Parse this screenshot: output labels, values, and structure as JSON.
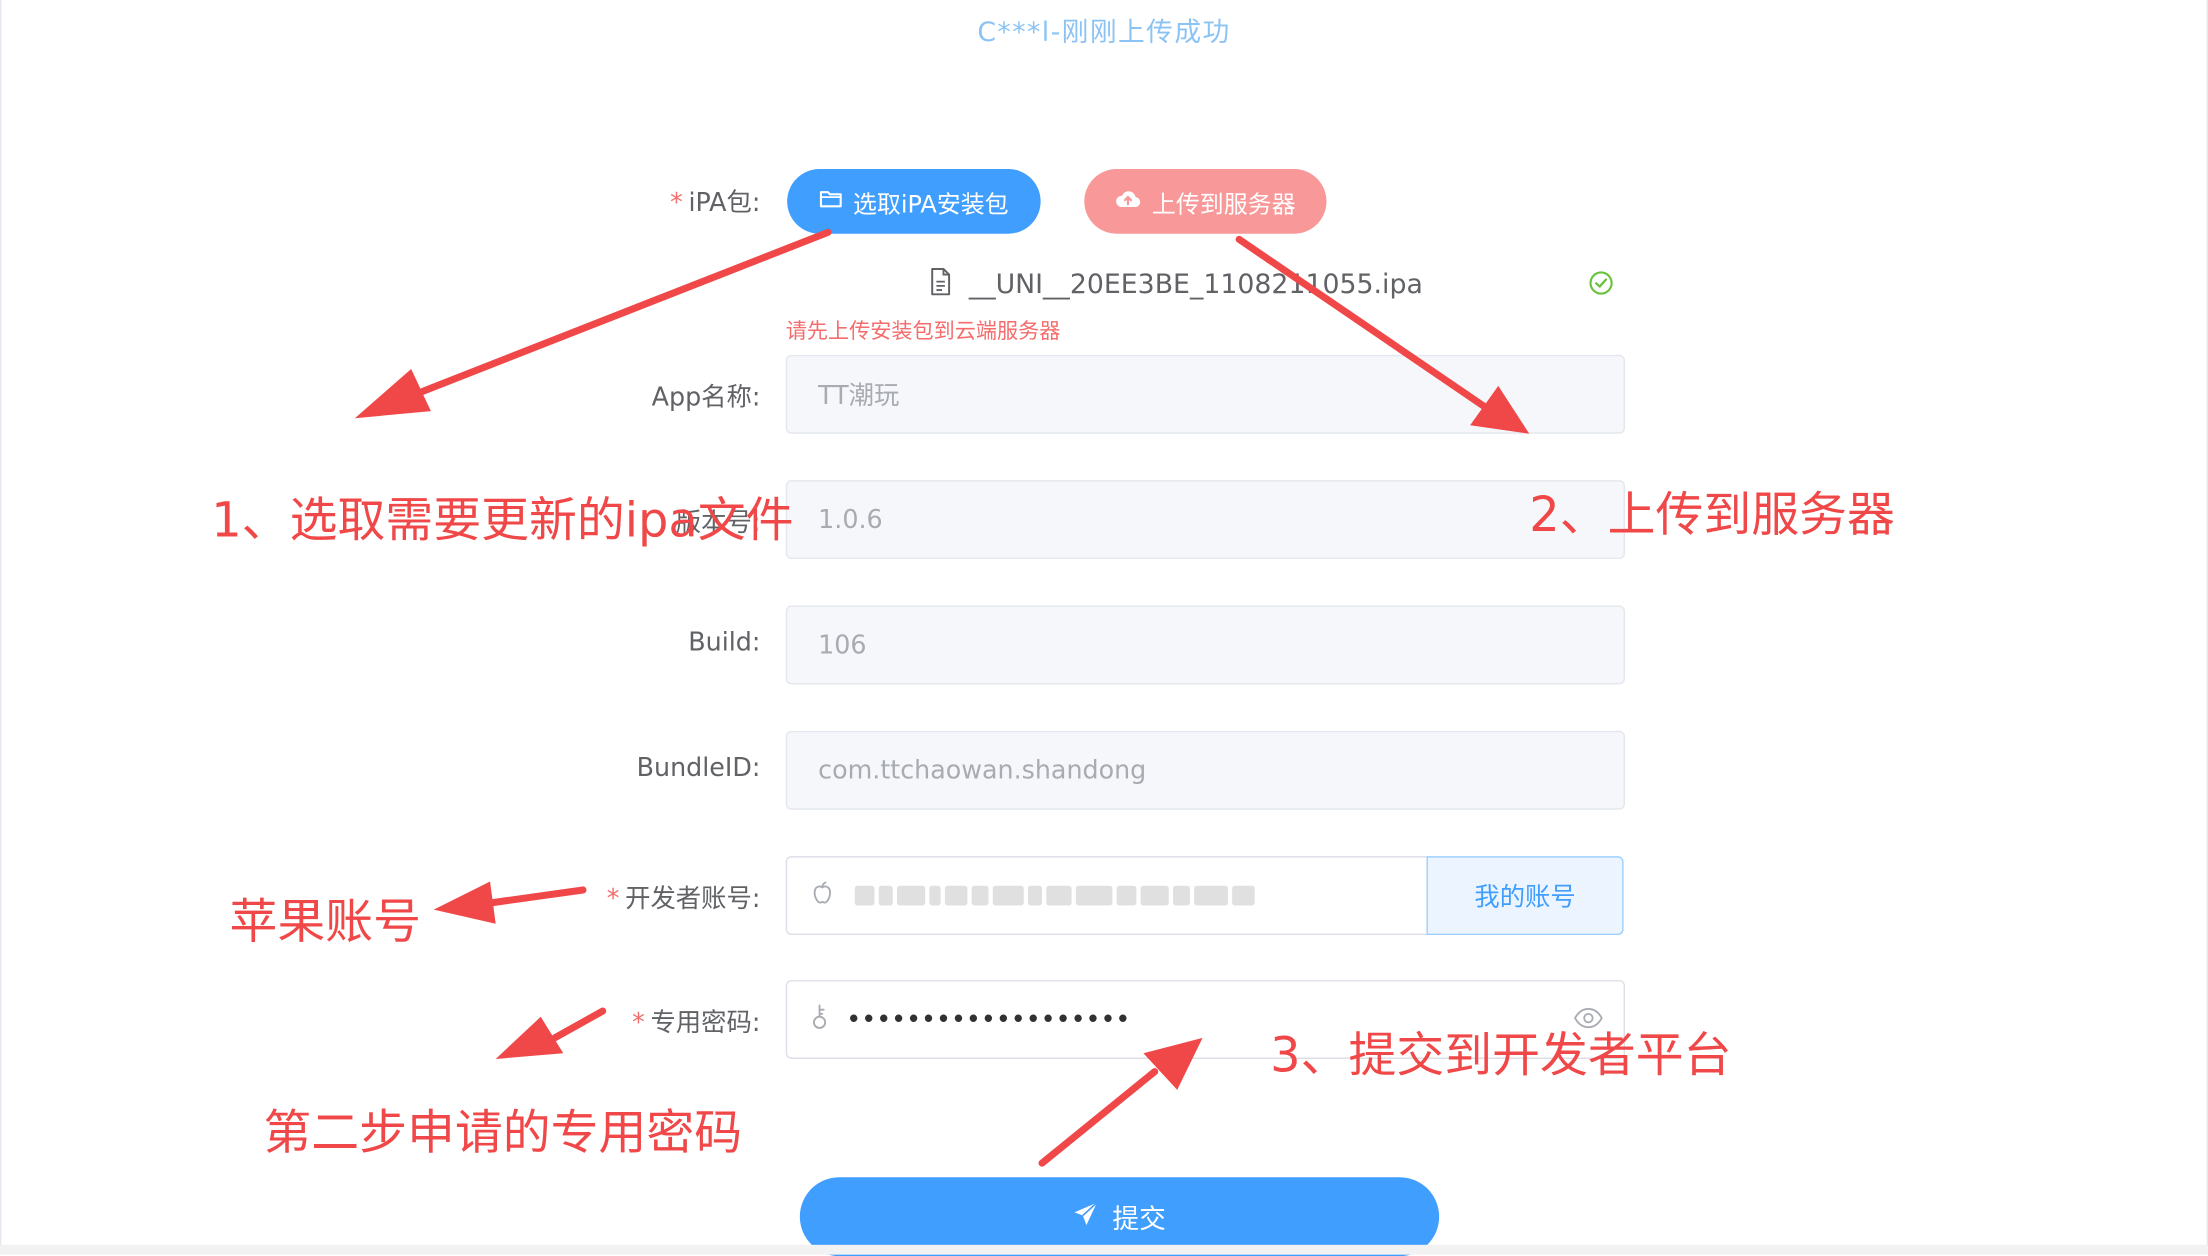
{
  "header": {
    "title": "C***l-刚刚上传成功"
  },
  "form": {
    "ipa_label": "iPA包:",
    "select_btn": "选取iPA安装包",
    "upload_btn": "上传到服务器",
    "file_name": "__UNI__20EE3BE_1108211055.ipa",
    "error_tip": "请先上传安装包到云端服务器",
    "app_name_label": "App名称:",
    "app_name_value": "TT潮玩",
    "version_label": "版本号:",
    "version_value": "1.0.6",
    "build_label": "Build:",
    "build_value": "106",
    "bundle_label": "BundleID:",
    "bundle_value": "com.ttchaowan.shandong",
    "dev_account_label": "开发者账号:",
    "my_account_btn": "我的账号",
    "password_label": "专用密码:",
    "password_value": "•••••••••••••••••••",
    "submit_btn": "提交",
    "required_mark": "*"
  },
  "annotations": {
    "step1": "1、选取需要更新的ipa文件",
    "step2": "2、上传到服务器",
    "step3": "3、提交到开发者平台",
    "apple_account": "苹果账号",
    "password_note": "第二步申请的专用密码"
  },
  "colors": {
    "primary": "#409eff",
    "danger": "#f56c6c",
    "upload_btn": "#f89898",
    "annotation": "#f04848",
    "success": "#67c23a"
  },
  "icons": [
    "folder-icon",
    "cloud-upload-icon",
    "document-icon",
    "check-circle-icon",
    "apple-icon",
    "key-icon",
    "eye-icon",
    "send-icon"
  ]
}
